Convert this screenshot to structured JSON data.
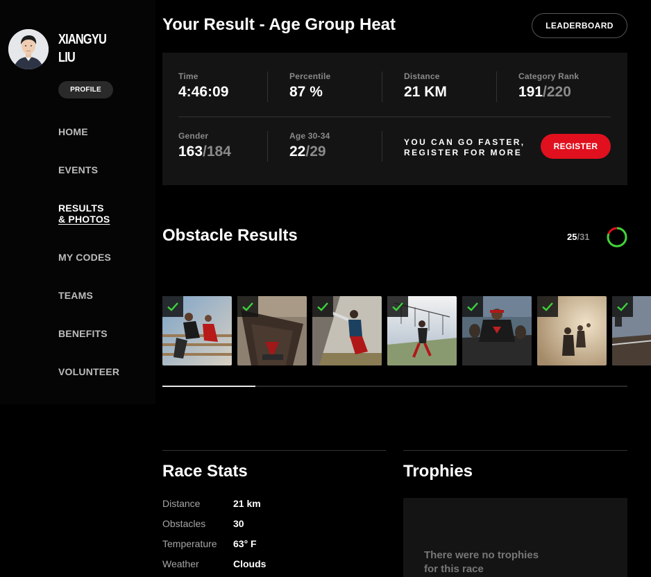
{
  "user": {
    "name": "XIANGYU LIU",
    "profile_label": "PROFILE"
  },
  "nav": {
    "items": [
      {
        "label": "HOME"
      },
      {
        "label": "EVENTS"
      },
      {
        "label_line1": "RESULTS",
        "label_line2": "& PHOTOS",
        "active": true
      },
      {
        "label": "MY CODES"
      },
      {
        "label": "TEAMS"
      },
      {
        "label": "BENEFITS"
      },
      {
        "label": "VOLUNTEER"
      }
    ]
  },
  "header": {
    "title": "Your Result - Age Group Heat",
    "leaderboard_label": "LEADERBOARD"
  },
  "result": {
    "time": {
      "label": "Time",
      "value": "4:46:09"
    },
    "percentile": {
      "label": "Percentile",
      "value": "87 %"
    },
    "distance": {
      "label": "Distance",
      "value": "21 KM"
    },
    "category_rank": {
      "label": "Category Rank",
      "value": "191",
      "total": "/220"
    },
    "gender": {
      "label": "Gender",
      "value": "163",
      "total": "/184"
    },
    "age": {
      "label": "Age 30-34",
      "value": "22",
      "total": "/29"
    },
    "cta_line1": "YOU CAN GO FASTER,",
    "cta_line2": "REGISTER FOR MORE",
    "register_label": "REGISTER"
  },
  "obstacles": {
    "title": "Obstacle Results",
    "completed": "25",
    "total": "/31",
    "completion_fraction": 0.806,
    "colors": {
      "success": "#3bd43b",
      "fail": "#e0101e",
      "accent": "#e0101e"
    },
    "thumbs": [
      {
        "status": "completed"
      },
      {
        "status": "completed"
      },
      {
        "status": "completed"
      },
      {
        "status": "completed"
      },
      {
        "status": "completed"
      },
      {
        "status": "completed"
      },
      {
        "status": "completed"
      }
    ]
  },
  "race_stats": {
    "title": "Race Stats",
    "rows": [
      {
        "label": "Distance",
        "value": "21 km"
      },
      {
        "label": "Obstacles",
        "value": "30"
      },
      {
        "label": "Temperature",
        "value": "63° F"
      },
      {
        "label": "Weather",
        "value": "Clouds"
      }
    ]
  },
  "trophies": {
    "title": "Trophies",
    "empty_line1": "There were no trophies",
    "empty_line2": "for this race"
  }
}
